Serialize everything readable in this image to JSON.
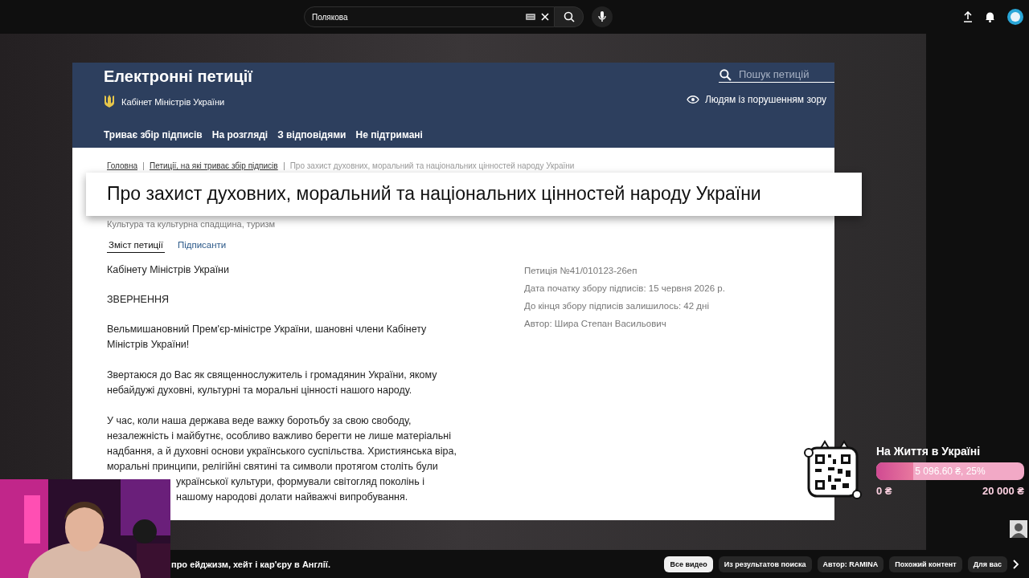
{
  "search": {
    "value": "Полякова"
  },
  "site": {
    "title": "Електронні петиції",
    "subtitle": "Кабінет Міністрів України",
    "search_placeholder": "Пошук петицій",
    "accessibility": "Людям із порушенням зору",
    "nav": [
      "Триває збір підписів",
      "На розгляді",
      "З відповідями",
      "Не підтримані"
    ]
  },
  "breadcrumbs": [
    "Головна",
    "Петиції, на які триває збір підписів",
    "Про захист духовних, моральний та національних цінностей народу України"
  ],
  "petition": {
    "title": "Про захист духовних, моральний та національних цінностей народу України",
    "category": "Культура та культурна спадщина, туризм",
    "tabs": [
      {
        "label": "Зміст петиції",
        "selected": true
      },
      {
        "label": "Підписанти",
        "selected": false
      }
    ],
    "addressee": "Кабінету Міністрів України",
    "heading": "ЗВЕРНЕННЯ",
    "paragraphs": [
      [
        "Вельмишановний Прем'єр-міністре України, шановні члени Кабінету",
        "Міністрів України!"
      ],
      [
        "Звертаюся до Вас як священнослужитель і громадянин України, якому",
        "небайдужі духовні, культурні та моральні цінності нашого народу."
      ],
      [
        "У час, коли наша держава веде важку боротьбу за свою свободу,",
        "незалежність і майбутнє, особливо важливо берегти не лише матеріальні",
        "надбання, а й духовні основи українського суспільства. Християнська віра,",
        "моральні принципи, релігійні святині та символи протягом століть були",
        "української культури, формували світогляд поколінь і",
        "нашому народові долати найважчі випробування."
      ]
    ],
    "meta": [
      "Петиція №41/010123-26еп",
      "Дата початку збору підписів: 15 червня 2026 р.",
      "До кінця збору підписів залишилось: 42 дні",
      "Автор: Шира Степан Васильович"
    ]
  },
  "donation": {
    "title": "На Життя в Україні",
    "reading": "5 096.60 ₴, 25%",
    "level": 0.25,
    "min": "0 ₴",
    "max": "20 000 ₴"
  },
  "video_title": "про ейджизм, хейт і кар'єру в Англії.",
  "chips": [
    {
      "label": "Все видео",
      "selected": true
    },
    {
      "label": "Из результатов поиска",
      "selected": false
    },
    {
      "label": "Автор: RAMINA",
      "selected": false
    },
    {
      "label": "Похожий контент",
      "selected": false
    },
    {
      "label": "Для вас",
      "selected": false
    }
  ]
}
